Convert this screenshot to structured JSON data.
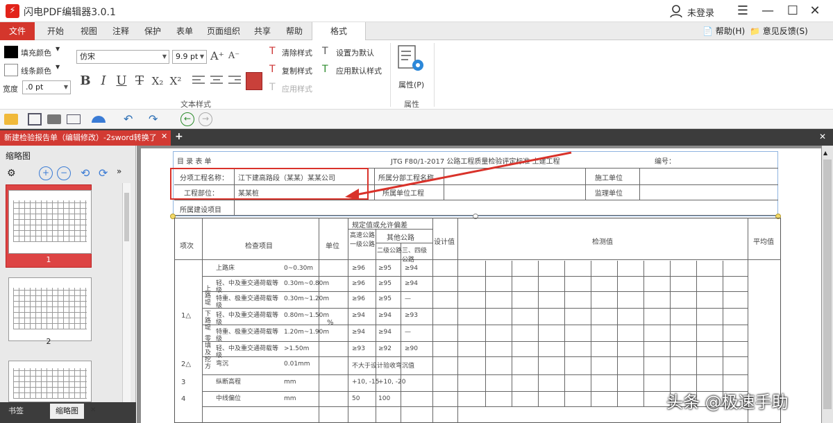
{
  "app": {
    "title": "闪电PDF编辑器3.0.1",
    "user_label": "未登录"
  },
  "ribbon_tabs": [
    "文件",
    "开始",
    "视图",
    "注释",
    "保护",
    "表单",
    "页面组织",
    "共享",
    "帮助",
    "格式"
  ],
  "ribbon_right": {
    "help": "帮助(H)",
    "feedback": "意见反馈(S)"
  },
  "ribbon": {
    "fill_color": "填充颜色",
    "line_color": "线条颜色",
    "width_label": "宽度",
    "width_value": ".0 pt",
    "font_family": "仿宋",
    "font_size": "9.9 pt",
    "clear_style": "清除样式",
    "set_default": "设置为默认",
    "copy_style": "复制样式",
    "apply_default": "应用默认样式",
    "apply_style": "应用样式",
    "text_style_group": "文本样式",
    "properties": "属性(P)",
    "properties_group": "属性",
    "format_buttons": [
      "B",
      "I",
      "U",
      "T",
      "X₂",
      "X²"
    ]
  },
  "doc_tab": {
    "title": "新建检验报告单（编辑修改）-2sword转换了"
  },
  "sidebar": {
    "header": "缩略图",
    "tab_bookmarks": "书签",
    "tab_thumbs": "缩略图",
    "pages": [
      "1",
      "2"
    ]
  },
  "table": {
    "header_left": "目 录 表 单",
    "header_center": "JTG F80/1-2017 公路工程质量检验评定标准 土建工程",
    "header_right": "编号：",
    "row1_label": "分项工程名称：",
    "row1_value": "江下建高路段（某某）某某公司",
    "row1_mid": "所属分部工程名称",
    "row1_right": "施工单位",
    "row2_label": "工程部位：",
    "row2_value": "某某桩",
    "row2_mid": "所属单位工程",
    "row2_right": "监理单位",
    "row3_label": "所属建设项目",
    "col_item": "项次",
    "col_check": "检查项目",
    "col_unit": "单位",
    "col_spec": "规定值或允许偏差",
    "col_spec_a": "高速公路一级公路",
    "col_spec_b": "其他公路",
    "col_spec_b1": "二级公路",
    "col_spec_b2": "三、四级公路",
    "col_design": "设计值",
    "col_measured": "检测值",
    "col_avg": "平均值",
    "rows": [
      {
        "item": "",
        "name": "上路床",
        "depth": "0~0.30m",
        "a": "≥96",
        "b1": "≥95",
        "b2": "≥94"
      },
      {
        "item": "",
        "name": "轻、中及重交通荷载等级",
        "depth": "0.30m~0.80m",
        "a": "≥96",
        "b1": "≥95",
        "b2": "≥94"
      },
      {
        "item": "",
        "name": "特重、极重交通荷载等级",
        "depth": "0.30m~1.20m",
        "a": "≥96",
        "b1": "≥95",
        "b2": "—"
      },
      {
        "item": "1△",
        "name": "轻、中及重交通荷载等级",
        "depth": "0.80m~1.50m",
        "a": "≥94",
        "b1": "≥94",
        "b2": "≥93"
      },
      {
        "item": "",
        "name": "特重、极重交通荷载等级",
        "depth": "1.20m~1.90m",
        "a": "≥94",
        "b1": "≥94",
        "b2": "—"
      },
      {
        "item": "",
        "name": "轻、中及重交通荷载等级",
        "depth": ">1.50m",
        "a": "≥93",
        "b1": "≥92",
        "b2": "≥90"
      },
      {
        "item": "2△",
        "name": "弯沉",
        "depth": "0.01mm",
        "a": "不大于设计验收弯沉值",
        "b1": "",
        "b2": ""
      },
      {
        "item": "3",
        "name": "纵断高程",
        "depth": "mm",
        "a": "+10, -15",
        "b1": "+10, -20",
        "b2": ""
      },
      {
        "item": "4",
        "name": "中线偏位",
        "depth": "mm",
        "a": "50",
        "b1": "100",
        "b2": ""
      }
    ],
    "unit_pct": "%",
    "side_labels": [
      "上路堤",
      "下路堤",
      "零填及挖方"
    ]
  },
  "watermark": "头条 @极速手助",
  "colors": {
    "accent": "#d4362c",
    "annotation": "#d9322a",
    "selection": "#8fb4e0"
  }
}
